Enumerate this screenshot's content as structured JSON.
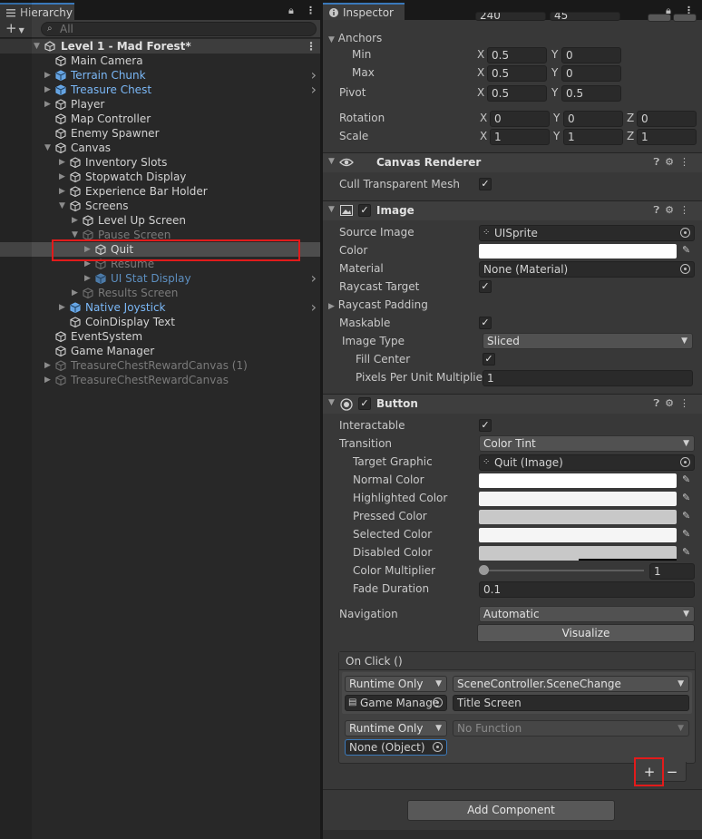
{
  "hierarchy": {
    "tab_label": "Hierarchy",
    "search_placeholder": "All",
    "scene_name": "Level 1 - Mad Forest*",
    "items": [
      {
        "label": "Main Camera",
        "depth": 1,
        "arrow": "",
        "style": "normal"
      },
      {
        "label": "Terrain Chunk",
        "depth": 1,
        "arrow": "right",
        "style": "prefab",
        "chevron": true
      },
      {
        "label": "Treasure Chest",
        "depth": 1,
        "arrow": "right",
        "style": "prefab",
        "chevron": true
      },
      {
        "label": "Player",
        "depth": 1,
        "arrow": "right",
        "style": "normal"
      },
      {
        "label": "Map Controller",
        "depth": 1,
        "arrow": "",
        "style": "normal"
      },
      {
        "label": "Enemy Spawner",
        "depth": 1,
        "arrow": "",
        "style": "normal"
      },
      {
        "label": "Canvas",
        "depth": 1,
        "arrow": "down",
        "style": "normal"
      },
      {
        "label": "Inventory Slots",
        "depth": 2,
        "arrow": "right",
        "style": "normal"
      },
      {
        "label": "Stopwatch Display",
        "depth": 2,
        "arrow": "right",
        "style": "normal"
      },
      {
        "label": "Experience Bar Holder",
        "depth": 2,
        "arrow": "right",
        "style": "normal"
      },
      {
        "label": "Screens",
        "depth": 2,
        "arrow": "down",
        "style": "normal"
      },
      {
        "label": "Level Up Screen",
        "depth": 3,
        "arrow": "right",
        "style": "normal"
      },
      {
        "label": "Pause Screen",
        "depth": 3,
        "arrow": "down",
        "style": "inactive"
      },
      {
        "label": "Quit",
        "depth": 4,
        "arrow": "right",
        "style": "selected"
      },
      {
        "label": "Resume",
        "depth": 4,
        "arrow": "right",
        "style": "inactive"
      },
      {
        "label": "UI Stat Display",
        "depth": 4,
        "arrow": "right",
        "style": "prefab-inactive",
        "chevron": true
      },
      {
        "label": "Results Screen",
        "depth": 3,
        "arrow": "right",
        "style": "inactive"
      },
      {
        "label": "Native Joystick",
        "depth": 2,
        "arrow": "right",
        "style": "prefab",
        "chevron": true
      },
      {
        "label": "CoinDisplay Text",
        "depth": 2,
        "arrow": "",
        "style": "normal"
      },
      {
        "label": "EventSystem",
        "depth": 1,
        "arrow": "",
        "style": "normal"
      },
      {
        "label": "Game Manager",
        "depth": 1,
        "arrow": "",
        "style": "normal"
      },
      {
        "label": "TreasureChestRewardCanvas (1)",
        "depth": 1,
        "arrow": "right",
        "style": "inactive"
      },
      {
        "label": "TreasureChestRewardCanvas",
        "depth": 1,
        "arrow": "right",
        "style": "inactive"
      }
    ]
  },
  "inspector": {
    "tab_label": "Inspector",
    "top_values": {
      "w": "240",
      "h": "45"
    },
    "anchors": {
      "label": "Anchors",
      "min_label": "Min",
      "min_x": "0.5",
      "min_y": "0",
      "max_label": "Max",
      "max_x": "0.5",
      "max_y": "0"
    },
    "pivot": {
      "label": "Pivot",
      "x": "0.5",
      "y": "0.5"
    },
    "rotation": {
      "label": "Rotation",
      "x": "0",
      "y": "0",
      "z": "0"
    },
    "scale": {
      "label": "Scale",
      "x": "1",
      "y": "1",
      "z": "1"
    },
    "axis": {
      "x": "X",
      "y": "Y",
      "z": "Z"
    },
    "canvas_renderer": {
      "title": "Canvas Renderer",
      "cull_label": "Cull Transparent Mesh"
    },
    "image": {
      "title": "Image",
      "source_image_label": "Source Image",
      "source_image_value": "UISprite",
      "color_label": "Color",
      "material_label": "Material",
      "material_value": "None (Material)",
      "raycast_target_label": "Raycast Target",
      "raycast_padding_label": "Raycast Padding",
      "maskable_label": "Maskable",
      "image_type_label": "Image Type",
      "image_type_value": "Sliced",
      "fill_center_label": "Fill Center",
      "ppu_label": "Pixels Per Unit Multiplier",
      "ppu_value": "1"
    },
    "button": {
      "title": "Button",
      "interactable_label": "Interactable",
      "transition_label": "Transition",
      "transition_value": "Color Tint",
      "target_graphic_label": "Target Graphic",
      "target_graphic_value": "Quit (Image)",
      "normal_color_label": "Normal Color",
      "highlighted_color_label": "Highlighted Color",
      "pressed_color_label": "Pressed Color",
      "selected_color_label": "Selected Color",
      "disabled_color_label": "Disabled Color",
      "color_multiplier_label": "Color Multiplier",
      "color_multiplier_value": "1",
      "fade_duration_label": "Fade Duration",
      "fade_duration_value": "0.1",
      "navigation_label": "Navigation",
      "navigation_value": "Automatic",
      "visualize_label": "Visualize"
    },
    "onclick": {
      "title": "On Click ()",
      "entries": [
        {
          "mode": "Runtime Only",
          "function": "SceneController.SceneChange",
          "object": "Game Manage",
          "argument": "Title Screen"
        },
        {
          "mode": "Runtime Only",
          "function": "No Function",
          "object": "None (Object)"
        }
      ],
      "add_label": "+",
      "remove_label": "−"
    },
    "add_component_label": "Add Component"
  },
  "colors": {
    "accent": "#3a79bb",
    "highlight_box": "#e21b1b",
    "prefab_text": "#7bb8f7",
    "normal_color": "#ffffff",
    "highlighted_color": "#f5f5f5",
    "pressed_color": "#c8c8c8",
    "selected_color": "#f5f5f5",
    "disabled_color": "#c8c8c8"
  },
  "icons": [
    "hamburger-icon",
    "lock-icon",
    "kebab-icon",
    "plus-icon",
    "search-icon",
    "unity-scene-icon",
    "gameobject-cube-icon",
    "info-icon",
    "eye-icon",
    "image-icon",
    "button-icon",
    "help-icon",
    "sliders-icon",
    "color-picker-icon",
    "object-target-icon",
    "script-icon",
    "sprite-icon"
  ]
}
